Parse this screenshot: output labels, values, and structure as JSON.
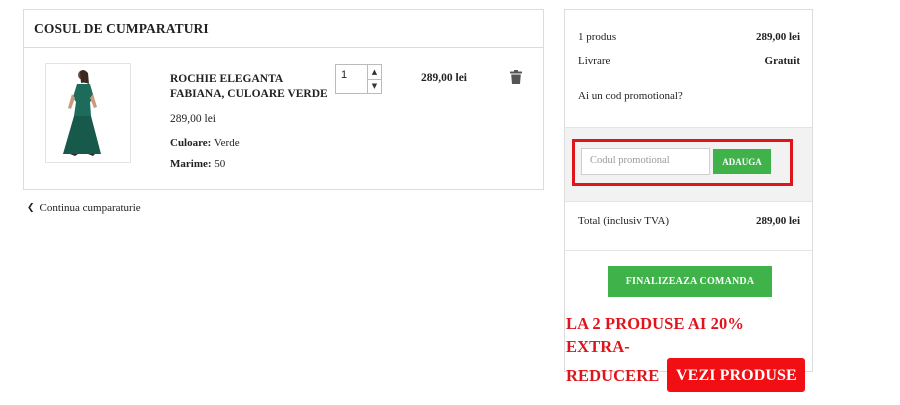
{
  "cart": {
    "title": "COSUL DE CUMPARATURI",
    "item": {
      "name": "ROCHIE ELEGANTA FABIANA, CULOARE VERDE",
      "unit_price": "289,00 lei",
      "color_label": "Culoare:",
      "color_value": "Verde",
      "size_label": "Marime:",
      "size_value": "50",
      "quantity": "1",
      "line_total": "289,00 lei"
    },
    "continue_label": "Continua cumparaturie"
  },
  "summary": {
    "products_label": "1 produs",
    "products_value": "289,00 lei",
    "delivery_label": "Livrare",
    "delivery_value": "Gratuit",
    "promo_link": "Ai un cod promotional?",
    "promo_placeholder": "Codul promotional",
    "promo_button": "ADAUGA",
    "total_label": "Total (inclusiv TVA)",
    "total_value": "289,00 lei",
    "checkout_button": "FINALIZEAZA COMANDA"
  },
  "banner": {
    "line1": "LA 2 PRODUSE AI 20% EXTRA-",
    "line2": "REDUCERE",
    "button": "VEZI PRODUSE"
  },
  "colors": {
    "accent_green": "#3fb24a",
    "promo_red": "#e0141b",
    "dress_green": "#1d6b5a"
  },
  "icons": {
    "delete": "trash-icon",
    "back": "chevron-left-icon",
    "qty_up": "chevron-up-icon",
    "qty_down": "chevron-down-icon"
  }
}
